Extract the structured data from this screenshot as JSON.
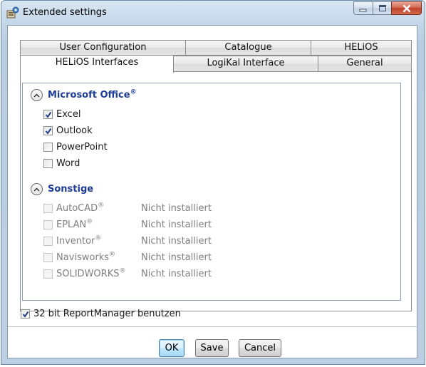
{
  "window": {
    "title": "Extended settings"
  },
  "tabs": {
    "row1": [
      "User Configuration",
      "Catalogue",
      "HELiOS"
    ],
    "row2": [
      "HELiOS Interfaces",
      "LogiKal Interface",
      "General"
    ],
    "active": "HELiOS Interfaces"
  },
  "groups": {
    "office": {
      "title": "Microsoft Office",
      "title_mark": "®",
      "items": [
        {
          "label": "Excel",
          "checked": true
        },
        {
          "label": "Outlook",
          "checked": true
        },
        {
          "label": "PowerPoint",
          "checked": false
        },
        {
          "label": "Word",
          "checked": false
        }
      ]
    },
    "other": {
      "title": "Sonstige",
      "items": [
        {
          "label": "AutoCAD",
          "mark": "®",
          "status": "Nicht installiert"
        },
        {
          "label": "EPLAN",
          "mark": "®",
          "status": "Nicht installiert"
        },
        {
          "label": "Inventor",
          "mark": "®",
          "status": "Nicht installiert"
        },
        {
          "label": "Navisworks",
          "mark": "®",
          "status": "Nicht installiert"
        },
        {
          "label": "SOLIDWORKS",
          "mark": "®",
          "status": "Nicht installiert"
        }
      ]
    }
  },
  "report_manager": {
    "label": "32 bit ReportManager benutzen",
    "checked": true
  },
  "buttons": {
    "ok": "OK",
    "save": "Save",
    "cancel": "Cancel"
  },
  "colors": {
    "group_title": "#1d3c96",
    "disabled_text": "#7f7f7f",
    "close_button": "#c0402a"
  }
}
